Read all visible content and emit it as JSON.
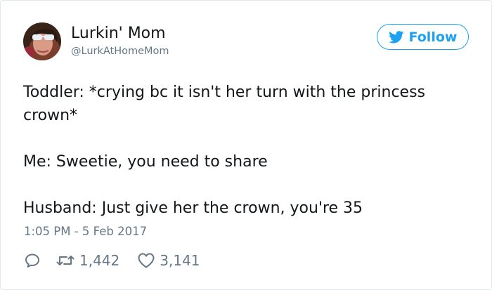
{
  "user": {
    "display_name": "Lurkin' Mom",
    "handle": "@LurkAtHomeMom",
    "avatar_icon": "profile-photo-avatar"
  },
  "follow_button": {
    "label": "Follow",
    "icon": "twitter-bird-icon"
  },
  "tweet": {
    "lines": [
      "Toddler: *crying bc it isn't her turn with the princess crown*",
      "Me: Sweetie, you need to share",
      "Husband: Just give her the crown, you're 35"
    ],
    "timestamp": "1:05 PM - 5 Feb 2017"
  },
  "actions": {
    "reply": {
      "icon": "reply-icon"
    },
    "retweet": {
      "icon": "retweet-icon",
      "count": "1,442"
    },
    "like": {
      "icon": "heart-icon",
      "count": "3,141"
    }
  },
  "colors": {
    "accent": "#1da1f2",
    "text_primary": "#14171a",
    "text_secondary": "#657786",
    "border": "#e1e8ed"
  }
}
